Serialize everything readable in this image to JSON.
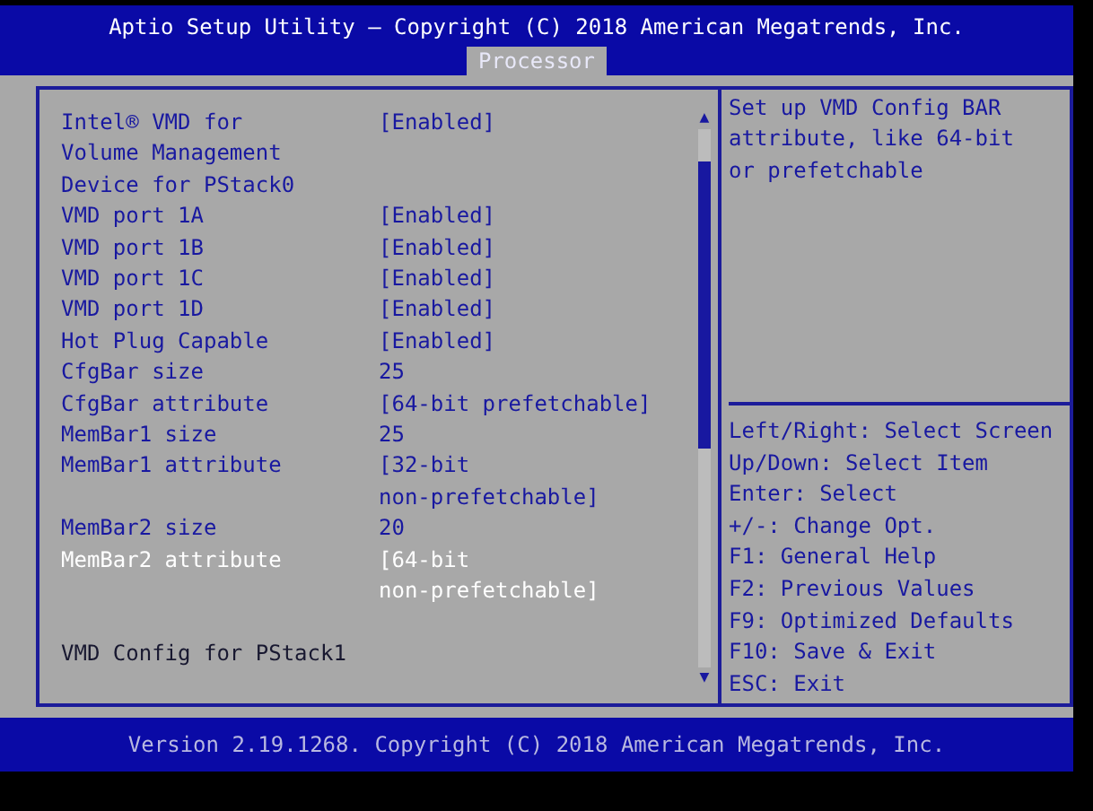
{
  "header": {
    "title": "Aptio Setup Utility – Copyright (C) 2018 American Megatrends, Inc."
  },
  "tabs": [
    {
      "label": "Processor",
      "selected": true
    }
  ],
  "settings": [
    {
      "kind": "setting",
      "label": "Intel® VMD for\nVolume Management\nDevice for PStack0",
      "value": "[Enabled]",
      "selected": false
    },
    {
      "kind": "setting",
      "label": "VMD port 1A",
      "value": "[Enabled]",
      "selected": false
    },
    {
      "kind": "setting",
      "label": "VMD port 1B",
      "value": "[Enabled]",
      "selected": false
    },
    {
      "kind": "setting",
      "label": "VMD port 1C",
      "value": "[Enabled]",
      "selected": false
    },
    {
      "kind": "setting",
      "label": "VMD port 1D",
      "value": "[Enabled]",
      "selected": false
    },
    {
      "kind": "setting",
      "label": "Hot Plug Capable",
      "value": "[Enabled]",
      "selected": false
    },
    {
      "kind": "setting",
      "label": "CfgBar size",
      "value": "25",
      "selected": false
    },
    {
      "kind": "setting",
      "label": "CfgBar attribute",
      "value": "[64-bit prefetchable]",
      "selected": false
    },
    {
      "kind": "setting",
      "label": "MemBar1 size",
      "value": "25",
      "selected": false
    },
    {
      "kind": "setting",
      "label": "MemBar1 attribute",
      "value": "[32-bit\nnon-prefetchable]",
      "selected": false
    },
    {
      "kind": "setting",
      "label": "MemBar2 size",
      "value": "20",
      "selected": false
    },
    {
      "kind": "setting",
      "label": "MemBar2 attribute",
      "value": "[64-bit\nnon-prefetchable]",
      "selected": true
    },
    {
      "kind": "heading",
      "label": "VMD Config for PStack1",
      "selected": false
    }
  ],
  "scrollbar": {
    "up": "▲",
    "down": "▼"
  },
  "help": "Set up VMD Config BAR\nattribute, like 64-bit\nor prefetchable",
  "keys": [
    "Left/Right: Select Screen",
    "Up/Down: Select Item",
    "Enter: Select",
    "+/-: Change Opt.",
    "F1: General Help",
    "F2: Previous Values",
    "F9: Optimized Defaults",
    "F10: Save & Exit",
    "ESC: Exit"
  ],
  "footer": "Version 2.19.1268. Copyright (C) 2018 American Megatrends, Inc."
}
